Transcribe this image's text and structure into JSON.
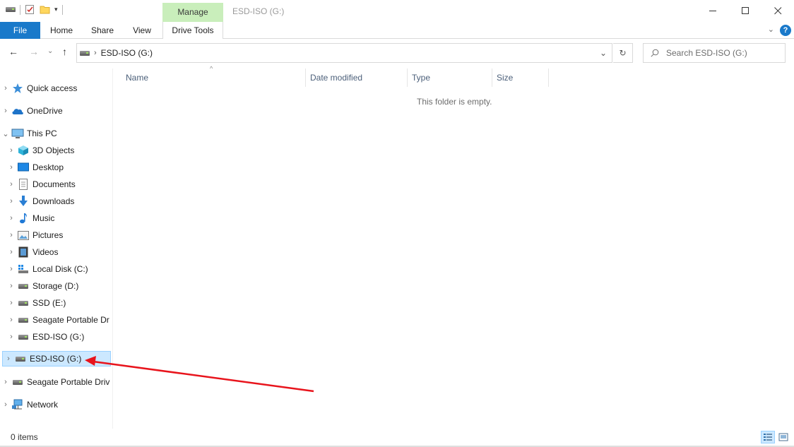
{
  "window": {
    "title": "ESD-ISO (G:)",
    "context_tab": "Manage",
    "minimize_glyph": "—",
    "maximize_glyph": "☐",
    "close_glyph": "✕"
  },
  "ribbon": {
    "tabs": [
      "File",
      "Home",
      "Share",
      "View",
      "Drive Tools"
    ],
    "help_glyph": "?",
    "collapse_glyph": "⌄"
  },
  "address": {
    "path": "ESD-ISO (G:)",
    "separator": "›",
    "dropdown_glyph": "⌄",
    "refresh_glyph": "↻"
  },
  "search": {
    "placeholder": "Search ESD-ISO (G:)"
  },
  "nav": {
    "back_glyph": "←",
    "forward_glyph": "→",
    "recent_glyph": "⌄",
    "up_glyph": "↑",
    "expand_glyph": "›",
    "expanded_glyph": "⌄",
    "items": [
      {
        "label": "Quick access",
        "icon": "star-icon"
      },
      {
        "label": "OneDrive",
        "icon": "cloud-icon"
      },
      {
        "label": "This PC",
        "icon": "computer-icon"
      },
      {
        "label": "3D Objects",
        "icon": "cube-icon"
      },
      {
        "label": "Desktop",
        "icon": "desktop-icon"
      },
      {
        "label": "Documents",
        "icon": "document-icon"
      },
      {
        "label": "Downloads",
        "icon": "download-icon"
      },
      {
        "label": "Music",
        "icon": "music-icon"
      },
      {
        "label": "Pictures",
        "icon": "picture-icon"
      },
      {
        "label": "Videos",
        "icon": "video-icon"
      },
      {
        "label": "Local Disk (C:)",
        "icon": "windows-drive-icon"
      },
      {
        "label": "Storage (D:)",
        "icon": "drive-icon"
      },
      {
        "label": "SSD (E:)",
        "icon": "drive-icon"
      },
      {
        "label": "Seagate Portable Dr",
        "icon": "drive-icon"
      },
      {
        "label": "ESD-ISO (G:)",
        "icon": "drive-icon"
      },
      {
        "label": "ESD-ISO (G:)",
        "icon": "drive-icon"
      },
      {
        "label": "Seagate Portable Driv",
        "icon": "drive-icon"
      },
      {
        "label": "Network",
        "icon": "network-icon"
      }
    ]
  },
  "columns": [
    "Name",
    "Date modified",
    "Type",
    "Size"
  ],
  "content": {
    "empty_message": "This folder is empty."
  },
  "status": {
    "item_count": "0 items"
  },
  "colors": {
    "accent": "#1979ca",
    "context_tab": "#c9eebb",
    "selection": "#cce8ff",
    "annotation_arrow": "#e8141c"
  }
}
